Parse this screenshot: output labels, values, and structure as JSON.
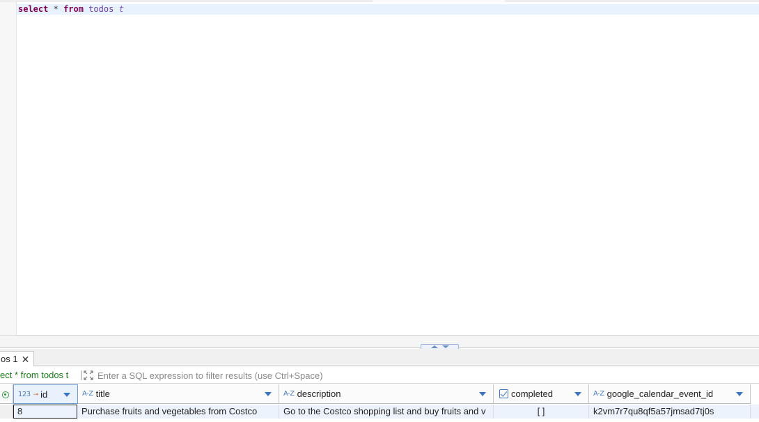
{
  "editor": {
    "sql_select": "select",
    "sql_star": "*",
    "sql_from": "from",
    "sql_table": "todos",
    "sql_alias": "t"
  },
  "results": {
    "tab_label": "os 1",
    "tab_close": "✕",
    "query_prefix": "ect ",
    "query_star": "*",
    "query_rest": " from todos t",
    "filter_placeholder": "Enter a SQL expression to filter results (use Ctrl+Space)"
  },
  "grid": {
    "columns": [
      {
        "type": "123",
        "name": "id",
        "key": "⊸"
      },
      {
        "type": "A-Z",
        "name": "title"
      },
      {
        "type": "A-Z",
        "name": "description"
      },
      {
        "type": "check",
        "name": "completed"
      },
      {
        "type": "A-Z",
        "name": "google_calendar_event_id"
      }
    ],
    "rows": [
      {
        "id": "8",
        "title": "Purchase fruits and vegetables from Costco",
        "description": "Go to the Costco shopping list and buy fruits and v",
        "completed": "[ ]",
        "google_calendar_event_id": "k2vm7r7qu8qf5a57jmsad7tj0s"
      }
    ]
  },
  "colors": {
    "keyword": "#7f0055",
    "identifier": "#6a3ea0",
    "query_text": "#1a7a1a",
    "accent": "#3a74c4",
    "row_highlight": "#ecf3fc"
  }
}
